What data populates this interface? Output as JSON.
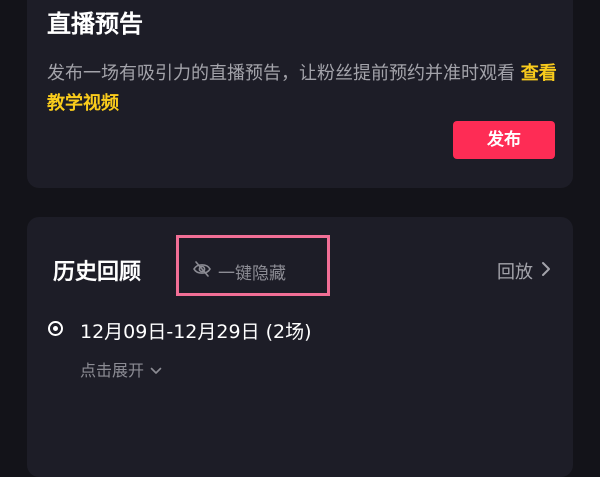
{
  "preview": {
    "title": "直播预告",
    "description": "发布一场有吸引力的直播预告，让粉丝提前预约并准时观看",
    "tutorial_link": "查看教学视频",
    "publish_button": "发布"
  },
  "history": {
    "title": "历史回顾",
    "hide_action": {
      "label": "一键隐藏",
      "icon": "eye-slash-icon"
    },
    "replay_link": {
      "label": "回放",
      "icon": "chevron-right-icon"
    },
    "entry": {
      "date_range": "12月09日-12月29日 (2场)",
      "expand_label": "点击展开",
      "expand_icon": "chevron-down-icon"
    }
  },
  "colors": {
    "background": "#131319",
    "card": "#1d1d27",
    "accent_link": "#facc1c",
    "publish_button": "#fe2c55",
    "highlight_box": "#f26f96"
  }
}
